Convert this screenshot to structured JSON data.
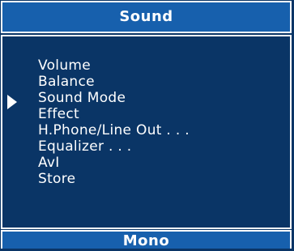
{
  "header": {
    "title": "Sound"
  },
  "menu": {
    "selected_index": 2,
    "items": [
      {
        "label": "Volume"
      },
      {
        "label": "Balance"
      },
      {
        "label": "Sound Mode"
      },
      {
        "label": "Effect"
      },
      {
        "label": "H.Phone/Line Out . . ."
      },
      {
        "label": "Equalizer . . ."
      },
      {
        "label": "AvI"
      },
      {
        "label": "Store"
      }
    ]
  },
  "footer": {
    "status": "Mono"
  },
  "colors": {
    "background": "#0a3566",
    "bar": "#1760ad",
    "text": "#ffffff"
  },
  "icons": {
    "cursor": "triangle-right-icon"
  }
}
